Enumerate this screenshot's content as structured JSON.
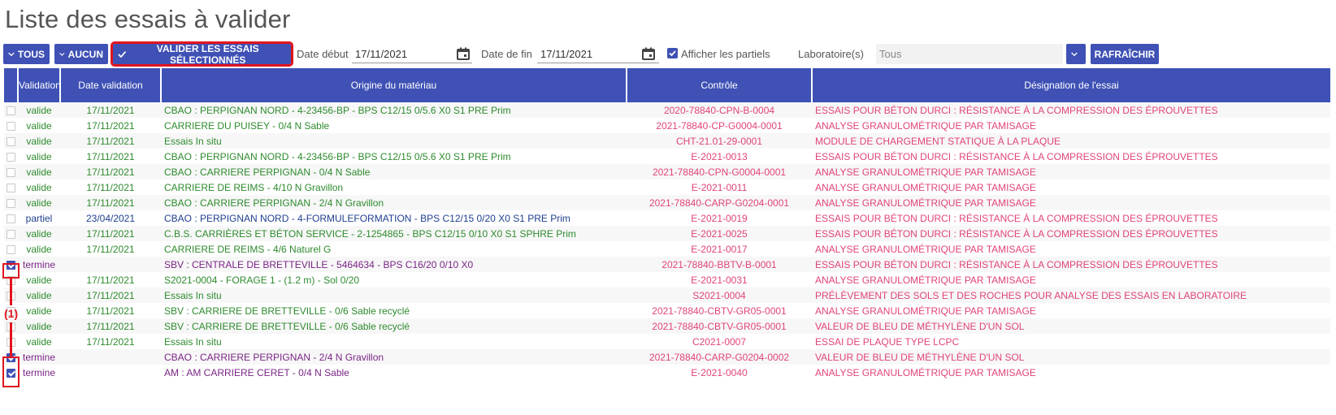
{
  "page": {
    "title": "Liste des essais à valider"
  },
  "toolbar": {
    "tous_label": "TOUS",
    "aucun_label": "AUCUN",
    "valider_label": "VALIDER LES ESSAIS SÉLECTIONNÉS",
    "date_debut_label": "Date début",
    "date_debut_value": "17/11/2021",
    "date_fin_label": "Date de fin",
    "date_fin_value": "17/11/2021",
    "partiels_label": "Afficher les partiels",
    "partiels_checked": true,
    "laboratoire_label": "Laboratoire(s)",
    "laboratoire_value": "Tous",
    "rafraichir_label": "RAFRAÎCHIR"
  },
  "table": {
    "headers": {
      "validation": "Validation",
      "date_validation": "Date validation",
      "origine": "Origine du matériau",
      "controle": "Contrôle",
      "designation": "Désignation de l'essai"
    },
    "rows": [
      {
        "checked": false,
        "status": "valide",
        "date": "17/11/2021",
        "origine": "CBAO : PERPIGNAN NORD - 4-23456-BP - BPS C12/15 0/5.6 X0 S1 PRE Prim",
        "controle": "2020-78840-CPN-B-0004",
        "designation": "ESSAIS POUR BÉTON DURCI : RÉSISTANCE À LA COMPRESSION DES ÉPROUVETTES",
        "color": "green"
      },
      {
        "checked": false,
        "status": "valide",
        "date": "17/11/2021",
        "origine": "CARRIERE DU PUISEY - 0/4 N Sable",
        "controle": "2021-78840-CP-G0004-0001",
        "designation": "ANALYSE GRANULOMÉTRIQUE PAR TAMISAGE",
        "color": "green"
      },
      {
        "checked": false,
        "status": "valide",
        "date": "17/11/2021",
        "origine": "Essais In situ",
        "controle": "CHT-21.01-29-0001",
        "designation": "MODULE DE CHARGEMENT STATIQUE À LA PLAQUE",
        "color": "green"
      },
      {
        "checked": false,
        "status": "valide",
        "date": "17/11/2021",
        "origine": "CBAO : PERPIGNAN NORD - 4-23456-BP - BPS C12/15 0/5.6 X0 S1 PRE Prim",
        "controle": "E-2021-0013",
        "designation": "ESSAIS POUR BÉTON DURCI : RÉSISTANCE À LA COMPRESSION DES ÉPROUVETTES",
        "color": "green"
      },
      {
        "checked": false,
        "status": "valide",
        "date": "17/11/2021",
        "origine": "CBAO : CARRIERE PERPIGNAN - 0/4 N Sable",
        "controle": "2021-78840-CPN-G0004-0001",
        "designation": "ANALYSE GRANULOMÉTRIQUE PAR TAMISAGE",
        "color": "green"
      },
      {
        "checked": false,
        "status": "valide",
        "date": "17/11/2021",
        "origine": "CARRIERE DE REIMS - 4/10 N Gravillon",
        "controle": "E-2021-0011",
        "designation": "ANALYSE GRANULOMÉTRIQUE PAR TAMISAGE",
        "color": "green"
      },
      {
        "checked": false,
        "status": "valide",
        "date": "17/11/2021",
        "origine": "CBAO : CARRIERE PERPIGNAN - 2/4 N Gravillon",
        "controle": "2021-78840-CARP-G0204-0001",
        "designation": "ANALYSE GRANULOMÉTRIQUE PAR TAMISAGE",
        "color": "green"
      },
      {
        "checked": false,
        "status": "partiel",
        "date": "23/04/2021",
        "origine": "CBAO : PERPIGNAN NORD - 4-FORMULEFORMATION - BPS C12/15 0/20 X0 S1 PRE Prim",
        "controle": "E-2021-0019",
        "designation": "ESSAIS POUR BÉTON DURCI : RÉSISTANCE À LA COMPRESSION DES ÉPROUVETTES",
        "color": "blue"
      },
      {
        "checked": false,
        "status": "valide",
        "date": "17/11/2021",
        "origine": "C.B.S. CARRIÈRES ET BÉTON SERVICE - 2-1254865 - BPS C12/15 0/10 X0 S1 SPHRE Prim",
        "controle": "E-2021-0025",
        "designation": "ESSAIS POUR BÉTON DURCI : RÉSISTANCE À LA COMPRESSION DES ÉPROUVETTES",
        "color": "green"
      },
      {
        "checked": false,
        "status": "valide",
        "date": "17/11/2021",
        "origine": "CARRIERE DE REIMS - 4/6 Naturel G",
        "controle": "E-2021-0017",
        "designation": "ANALYSE GRANULOMÉTRIQUE PAR TAMISAGE",
        "color": "green"
      },
      {
        "checked": true,
        "status": "termine",
        "date": "",
        "origine": "SBV : CENTRALE DE BRETTEVILLE - 5464634 - BPS C16/20 0/10 X0",
        "controle": "2021-78840-BBTV-B-0001",
        "designation": "ESSAIS POUR BÉTON DURCI : RÉSISTANCE À LA COMPRESSION DES ÉPROUVETTES",
        "color": "purple"
      },
      {
        "checked": false,
        "status": "valide",
        "date": "17/11/2021",
        "origine": "S2021-0004 - FORAGE 1 - (1.2 m) - Sol 0/20",
        "controle": "E-2021-0031",
        "designation": "ANALYSE GRANULOMÉTRIQUE PAR TAMISAGE",
        "color": "green"
      },
      {
        "checked": false,
        "status": "valide",
        "date": "17/11/2021",
        "origine": "Essais In situ",
        "controle": "S2021-0004",
        "designation": "PRÉLÈVEMENT DES SOLS ET DES ROCHES POUR ANALYSE DES ESSAIS EN LABORATOIRE",
        "color": "green"
      },
      {
        "checked": false,
        "status": "valide",
        "date": "17/11/2021",
        "origine": "SBV : CARRIERE DE BRETTEVILLE - 0/6 Sable recyclé",
        "controle": "2021-78840-CBTV-GR05-0001",
        "designation": "ANALYSE GRANULOMÉTRIQUE PAR TAMISAGE",
        "color": "green"
      },
      {
        "checked": false,
        "status": "valide",
        "date": "17/11/2021",
        "origine": "SBV : CARRIERE DE BRETTEVILLE - 0/6 Sable recyclé",
        "controle": "2021-78840-CBTV-GR05-0001",
        "designation": "VALEUR DE BLEU DE MÉTHYLÈNE D'UN SOL",
        "color": "green"
      },
      {
        "checked": false,
        "status": "valide",
        "date": "17/11/2021",
        "origine": "Essais In situ",
        "controle": "C2021-0007",
        "designation": "ESSAI DE PLAQUE TYPE LCPC",
        "color": "green"
      },
      {
        "checked": true,
        "status": "termine",
        "date": "",
        "origine": "CBAO : CARRIERE PERPIGNAN - 2/4 N Gravillon",
        "controle": "2021-78840-CARP-G0204-0002",
        "designation": "VALEUR DE BLEU DE MÉTHYLÈNE D'UN SOL",
        "color": "purple"
      },
      {
        "checked": true,
        "status": "termine",
        "date": "",
        "origine": "AM : AM CARRIERE CERET - 0/4 N Sable",
        "controle": "E-2021-0040",
        "designation": "ANALYSE GRANULOMÉTRIQUE PAR TAMISAGE",
        "color": "purple"
      }
    ]
  },
  "annotation": {
    "label": "(1)"
  },
  "colors": {
    "primary": "#3f51b5",
    "valide": "#2e8b2e",
    "partiel": "#1f3f8f",
    "termine": "#7a2586",
    "accent": "#e0447a",
    "highlight": "#e0141e"
  }
}
